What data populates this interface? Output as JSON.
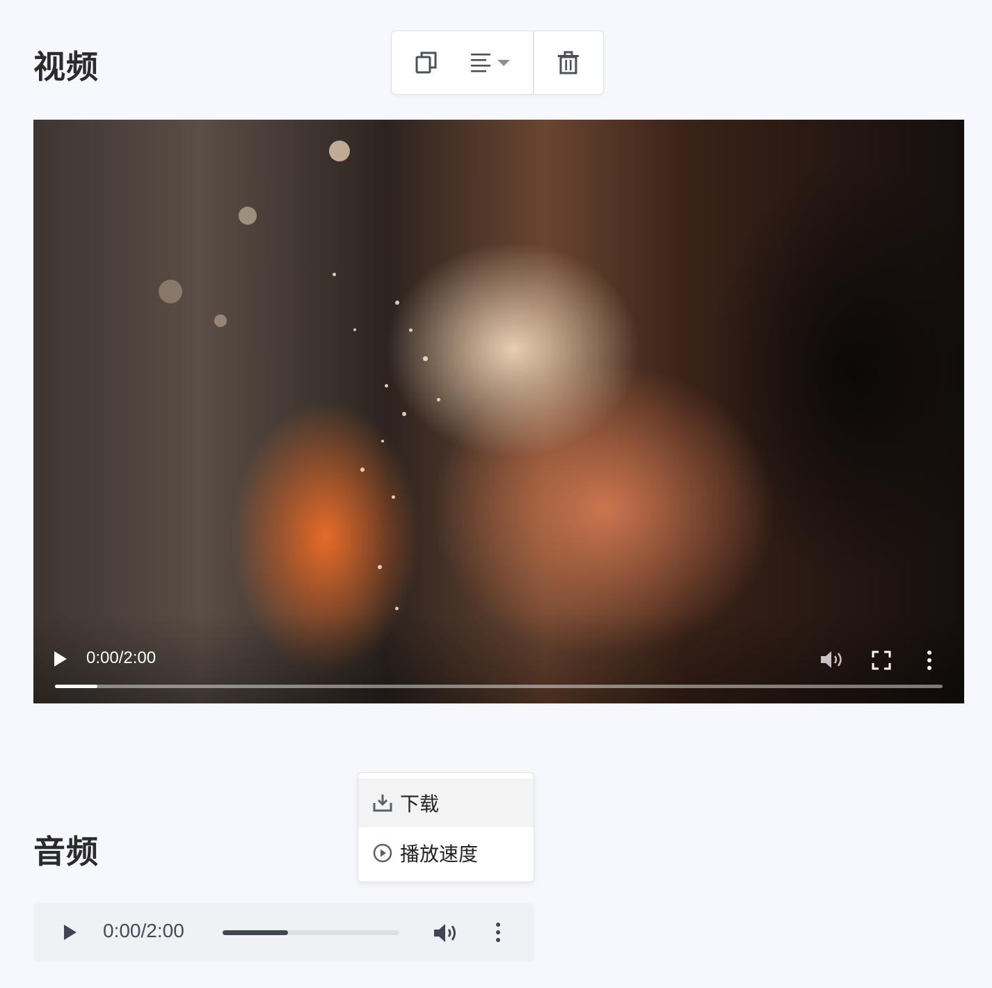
{
  "video_section": {
    "title": "视频"
  },
  "toolbar": {
    "icons": [
      "copy-icon",
      "align-left-icon",
      "chevron-down-icon",
      "trash-icon"
    ]
  },
  "video_player": {
    "time": "0:00/2:00",
    "progress_fraction": 0.048,
    "icons": [
      "play-icon",
      "volume-icon",
      "fullscreen-icon",
      "more-vertical-icon"
    ]
  },
  "context_menu": {
    "items": [
      {
        "label": "下载",
        "icon": "download-icon",
        "highlighted": true
      },
      {
        "label": "播放速度",
        "icon": "play-circle-icon",
        "highlighted": false
      }
    ]
  },
  "audio_section": {
    "title": "音频"
  },
  "audio_player": {
    "time": "0:00/2:00",
    "progress_fraction": 0.37,
    "icons": [
      "play-icon",
      "volume-icon",
      "more-vertical-icon"
    ]
  },
  "colors": {
    "page_background": "#f7f8fd",
    "title_text": "#2b2b2b",
    "audio_bar_background": "#f0f1f4",
    "audio_progress_fill": "#3f4654",
    "menu_highlight": "#f3f3f4"
  }
}
